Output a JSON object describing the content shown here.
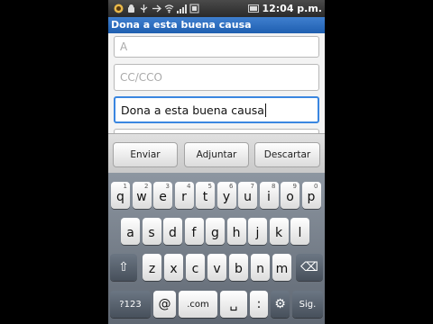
{
  "status_bar": {
    "icons": [
      "android-icon",
      "wifi-icon",
      "usb-icon",
      "signal-icon",
      "battery-icon"
    ],
    "time": "12:04 p.m."
  },
  "title": "Dona a esta buena causa",
  "form": {
    "to_placeholder": "A",
    "cc_placeholder": "CC/CCO",
    "subject_value": "Dona a esta buena causa"
  },
  "actions": {
    "send": "Enviar",
    "attach": "Adjuntar",
    "discard": "Descartar"
  },
  "keyboard": {
    "row1": [
      {
        "k": "q",
        "h": "1"
      },
      {
        "k": "w",
        "h": "2"
      },
      {
        "k": "e",
        "h": "3"
      },
      {
        "k": "r",
        "h": "4"
      },
      {
        "k": "t",
        "h": "5"
      },
      {
        "k": "y",
        "h": "6"
      },
      {
        "k": "u",
        "h": "7"
      },
      {
        "k": "i",
        "h": "8"
      },
      {
        "k": "o",
        "h": "9"
      },
      {
        "k": "p",
        "h": "0"
      }
    ],
    "row2": [
      "a",
      "s",
      "d",
      "f",
      "g",
      "h",
      "j",
      "k",
      "l"
    ],
    "row3": [
      "z",
      "x",
      "c",
      "v",
      "b",
      "n",
      "m"
    ],
    "shift": "⇧",
    "delete": "⌫",
    "symbols": "?123",
    "at": "@",
    "dotcom": ".com",
    "space": "␣",
    "colon": ":",
    "gear": "⚙",
    "next": "Sig."
  },
  "colors": {
    "title_bar": "#2a6cc0",
    "focus": "#3a86e0",
    "keyboard_bg": "#6f7884"
  }
}
